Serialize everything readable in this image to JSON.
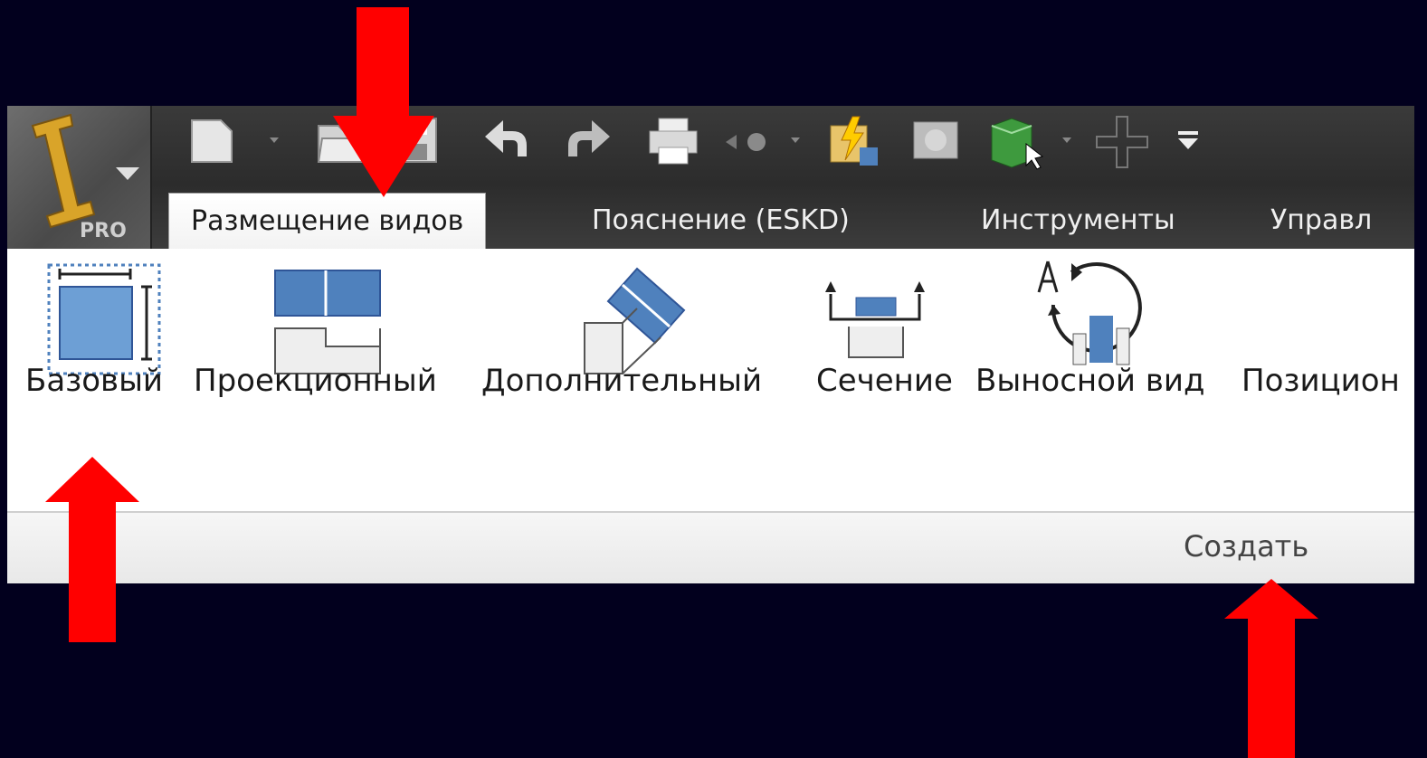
{
  "app": {
    "badge": "PRO"
  },
  "quick_access": {
    "icons": [
      "new-file-icon",
      "dropdown-icon",
      "open-folder-icon",
      "save-icon",
      "undo-icon",
      "redo-icon",
      "print-icon",
      "back-icon",
      "dropdown-icon",
      "update-icon",
      "material-icon",
      "view-cube-icon",
      "dropdown-icon",
      "crosshair-icon",
      "customize-icon"
    ]
  },
  "tabs": [
    {
      "label": "Размещение видов",
      "active": true
    },
    {
      "label": "Пояснение (ESKD)",
      "active": false
    },
    {
      "label": "Инструменты",
      "active": false
    },
    {
      "label": "Управл",
      "active": false
    }
  ],
  "tools": [
    {
      "label": "Базовый",
      "icon": "base-view-icon"
    },
    {
      "label": "Проекционный",
      "icon": "projected-view-icon"
    },
    {
      "label": "Дополнительный",
      "icon": "auxiliary-view-icon"
    },
    {
      "label": "Сечение",
      "icon": "section-view-icon"
    },
    {
      "label": "Выносной вид",
      "icon": "detail-view-icon"
    },
    {
      "label": "Позицион",
      "icon": ""
    }
  ],
  "panel": {
    "title": "Создать"
  },
  "colors": {
    "annotation_arrow": "#ff0000",
    "icon_blue": "#4f81bd",
    "background": "#02001e"
  }
}
